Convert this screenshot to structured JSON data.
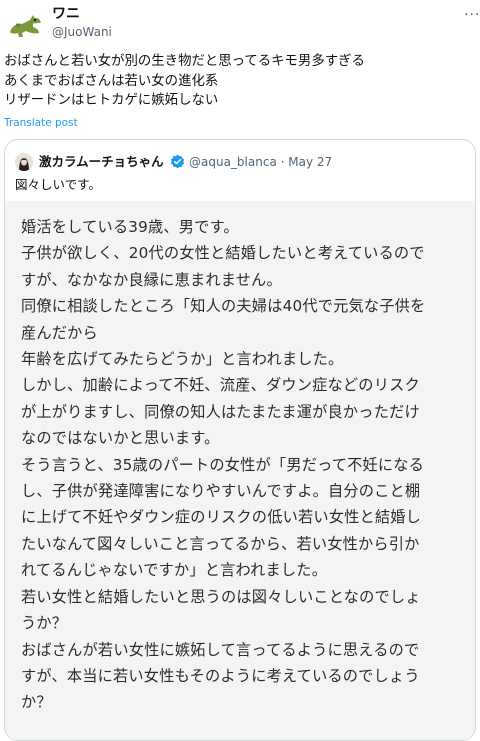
{
  "author": {
    "display_name": "ワニ",
    "handle": "@JuoWani"
  },
  "more_icon": "ellipsis-icon",
  "tweet_lines": [
    "おばさんと若い女が別の生き物だと思ってるキモ男多すぎる",
    "あくまでおばさんは若い女の進化系",
    "リザードンはヒトカゲに嫉妬しない"
  ],
  "translate_label": "Translate post",
  "quote": {
    "display_name": "激カラムーチョちゃん",
    "verified_icon": "verified-badge-icon",
    "handle_date": "@aqua_blanca · May 27",
    "text": "図々しいです。",
    "image_lines": [
      "婚活をしている39歳、男です。",
      "子供が欲しく、20代の女性と結婚したいと考えているので",
      "すが、なかなか良縁に恵まれません。",
      "同僚に相談したところ「知人の夫婦は40代で元気な子供を",
      "産んだから",
      "年齢を広げてみたらどうか」と言われました。",
      "しかし、加齢によって不妊、流産、ダウン症などのリスク",
      "が上がりますし、同僚の知人はたまたま運が良かっただけ",
      "なのではないかと思います。",
      "そう言うと、35歳のパートの女性が「男だって不妊になる",
      "し、子供が発達障害になりやすいんですよ。自分のこと棚",
      "に上げて不妊やダウン症のリスクの低い若い女性と結婚し",
      "たいなんて図々しいこと言ってるから、若い女性から引か",
      "れてるんじゃないですか」と言われました。",
      "若い女性と結婚したいと思うのは図々しいことなのでしょ",
      "うか？",
      "おばさんが若い女性に嫉妬して言ってるように思えるので",
      "すが、本当に若い女性もそのように考えているのでしょう",
      "か？"
    ]
  }
}
